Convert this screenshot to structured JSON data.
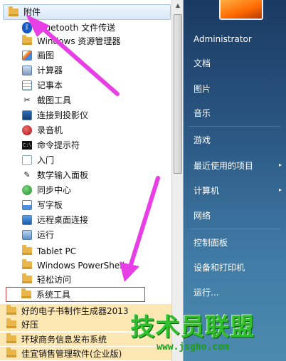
{
  "programs": {
    "accessories_folder": {
      "label": "附件",
      "icon": "folder-icon"
    },
    "items": [
      {
        "label": "Bluetooth 文件传送",
        "icon": "bluetooth-icon"
      },
      {
        "label": "Windows 资源管理器",
        "icon": "folder-icon"
      },
      {
        "label": "画图",
        "icon": "paint-icon"
      },
      {
        "label": "计算器",
        "icon": "calculator-icon"
      },
      {
        "label": "记事本",
        "icon": "notepad-icon"
      },
      {
        "label": "截图工具",
        "icon": "scissors-icon"
      },
      {
        "label": "连接到投影仪",
        "icon": "projector-icon"
      },
      {
        "label": "录音机",
        "icon": "microphone-icon"
      },
      {
        "label": "命令提示符",
        "icon": "cmd-icon"
      },
      {
        "label": "入门",
        "icon": "document-icon"
      },
      {
        "label": "数学输入面板",
        "icon": "pen-icon"
      },
      {
        "label": "同步中心",
        "icon": "sync-icon"
      },
      {
        "label": "写字板",
        "icon": "wordpad-icon"
      },
      {
        "label": "远程桌面连接",
        "icon": "remote-desktop-icon"
      },
      {
        "label": "运行",
        "icon": "run-icon"
      },
      {
        "label": "Tablet PC",
        "icon": "folder-icon"
      },
      {
        "label": "Windows PowerShell",
        "icon": "folder-icon"
      },
      {
        "label": "轻松访问",
        "icon": "folder-icon"
      },
      {
        "label": "系统工具",
        "icon": "folder-icon"
      }
    ],
    "top_level": [
      {
        "label": "好的电子书制作生成器2013",
        "icon": "folder-icon"
      },
      {
        "label": "好压",
        "icon": "folder-icon"
      },
      {
        "label": "环球商务信息发布系统",
        "icon": "folder-icon"
      },
      {
        "label": "佳宜销售管理软件(企业版)",
        "icon": "folder-icon"
      }
    ]
  },
  "right_pane": {
    "user": "Administrator",
    "items": [
      {
        "label": "文档"
      },
      {
        "label": "图片"
      },
      {
        "label": "音乐"
      },
      {
        "label": "游戏"
      },
      {
        "label": "最近使用的项目",
        "arrow": "▸"
      },
      {
        "label": "计算机",
        "arrow": "▸"
      },
      {
        "label": "网络"
      },
      {
        "label": "控制面板"
      },
      {
        "label": "设备和打印机"
      },
      {
        "label": "运行..."
      }
    ]
  },
  "watermark": {
    "title": "技术员联盟",
    "url": "www.jsgho.com"
  },
  "colors": {
    "annotation_arrow": "#e83ee6",
    "selection_box": "#e0383e",
    "highlight": "#fde7b2"
  }
}
